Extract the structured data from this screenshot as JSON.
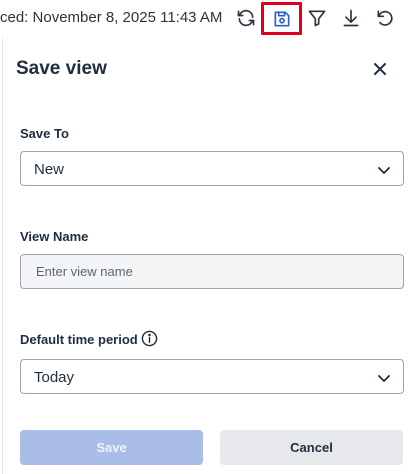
{
  "toolbar": {
    "last_updated_text": "ced: November 8, 2025 11:43 AM",
    "highlight_color": "#e0001b",
    "icons": [
      "refresh-icon",
      "save-icon",
      "filter-icon",
      "download-icon",
      "undo-icon"
    ]
  },
  "panel": {
    "title": "Save view",
    "close_icon": "close-icon",
    "save_to": {
      "label": "Save To",
      "value": "New"
    },
    "view_name": {
      "label": "View Name",
      "value": "",
      "placeholder": "Enter view name"
    },
    "default_time_period": {
      "label": "Default time period",
      "value": "Today",
      "info_icon": "info-icon"
    },
    "buttons": {
      "save_label": "Save",
      "save_disabled": true,
      "cancel_label": "Cancel"
    }
  },
  "colors": {
    "primary_disabled": "#a9bde6",
    "secondary_button": "#e6e8ec",
    "text": "#1f2d3d"
  }
}
